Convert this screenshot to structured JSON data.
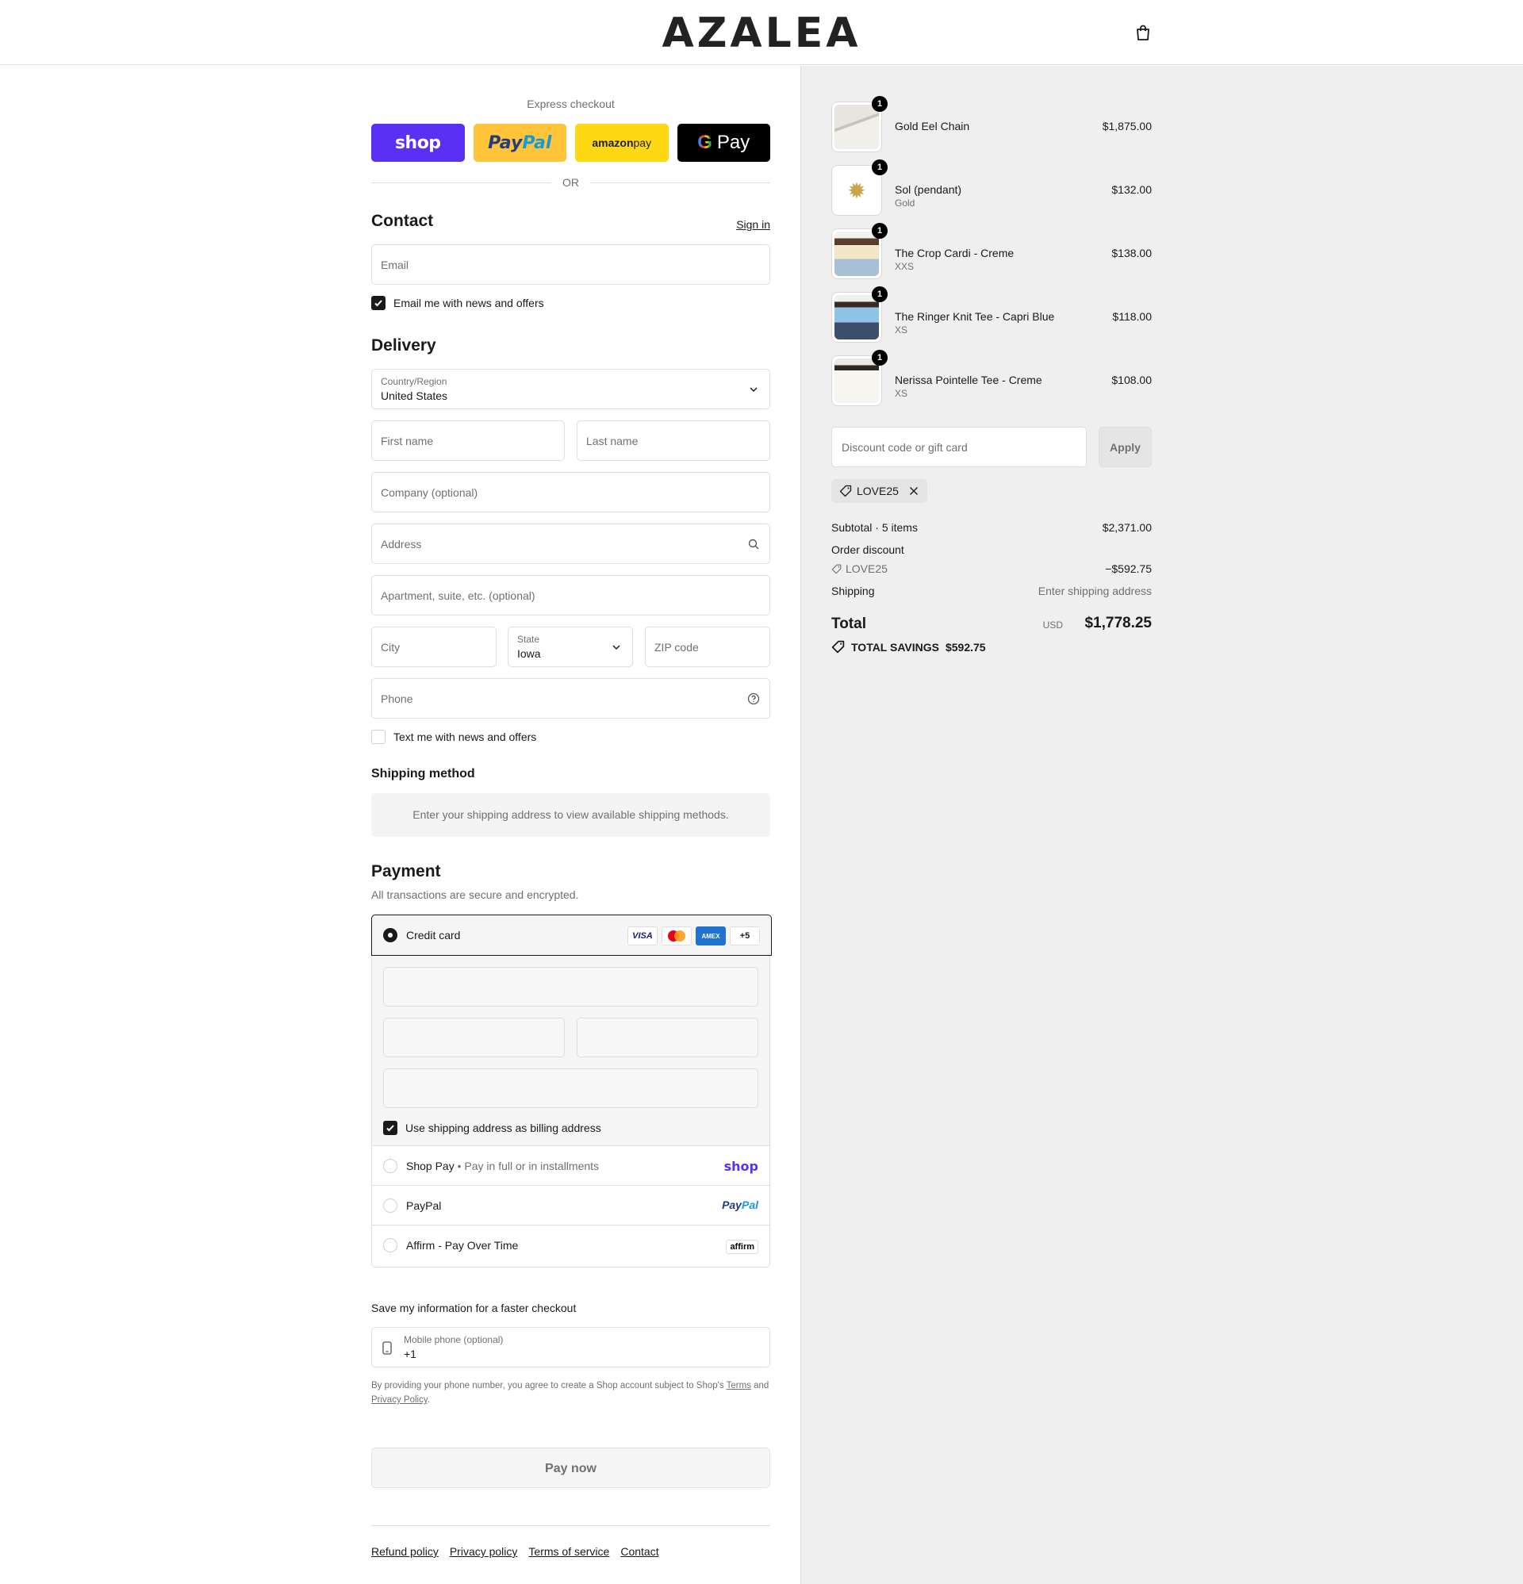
{
  "header": {
    "logo": "AZALEA",
    "cart_icon": "shopping-bag-icon"
  },
  "express": {
    "title": "Express checkout",
    "shop_label": "shop",
    "paypal_1": "Pay",
    "paypal_2": "Pal",
    "amazon_1": "amazon",
    "amazon_2": " pay",
    "gpay_g": "G",
    "gpay_label": "Pay",
    "or": "OR"
  },
  "contact": {
    "heading": "Contact",
    "sign_in": "Sign in",
    "email_placeholder": "Email",
    "email_opt_in": "Email me with news and offers",
    "email_opt_in_checked": true
  },
  "delivery": {
    "heading": "Delivery",
    "country_label": "Country/Region",
    "country_value": "United States",
    "first_name": "First name",
    "last_name": "Last name",
    "company": "Company (optional)",
    "address": "Address",
    "apartment": "Apartment, suite, etc. (optional)",
    "city": "City",
    "state_label": "State",
    "state_value": "Iowa",
    "zip": "ZIP code",
    "phone": "Phone",
    "sms_opt_in": "Text me with news and offers",
    "sms_opt_in_checked": false
  },
  "shipping_method": {
    "heading": "Shipping method",
    "notice": "Enter your shipping address to view available shipping methods."
  },
  "payment": {
    "heading": "Payment",
    "subtitle": "All transactions are secure and encrypted.",
    "credit_card": "Credit card",
    "card_visa": "VISA",
    "card_amex": "AMEX",
    "card_more": "+5",
    "billing_same": "Use shipping address as billing address",
    "billing_same_checked": true,
    "shop_pay": "Shop Pay",
    "shop_pay_sub": "Pay in full or in installments",
    "shop_pay_brand": "shop",
    "paypal": "PayPal",
    "paypal_brand_1": "Pay",
    "paypal_brand_2": "Pal",
    "affirm": "Affirm - Pay Over Time",
    "affirm_brand": "affirm"
  },
  "save_info": {
    "heading": "Save my information for a faster checkout",
    "mobile_label": "Mobile phone (optional)",
    "mobile_value": "+1",
    "fine_1": "By providing your phone number, you agree to create a Shop account subject to Shop's ",
    "fine_terms": "Terms",
    "fine_2": " and ",
    "fine_privacy": "Privacy Policy",
    "fine_3": "."
  },
  "pay_now": "Pay now",
  "footer": [
    "Refund policy",
    "Privacy policy",
    "Terms of service",
    "Contact"
  ],
  "summary": {
    "items": [
      {
        "name": "Gold Eel Chain",
        "variant": "",
        "price": "$1,875.00",
        "qty": "1"
      },
      {
        "name": "Sol (pendant)",
        "variant": "Gold",
        "price": "$132.00",
        "qty": "1"
      },
      {
        "name": "The Crop Cardi - Creme",
        "variant": "XXS",
        "price": "$138.00",
        "qty": "1"
      },
      {
        "name": "The Ringer Knit Tee - Capri Blue",
        "variant": "XS",
        "price": "$118.00",
        "qty": "1"
      },
      {
        "name": "Nerissa Pointelle Tee - Creme",
        "variant": "XS",
        "price": "$108.00",
        "qty": "1"
      }
    ],
    "discount_placeholder": "Discount code or gift card",
    "apply": "Apply",
    "applied_code": "LOVE25",
    "subtotal_label": "Subtotal · 5 items",
    "subtotal_value": "$2,371.00",
    "order_discount_label": "Order discount",
    "order_discount_code": "LOVE25",
    "order_discount_value": "−$592.75",
    "shipping_label": "Shipping",
    "shipping_value": "Enter shipping address",
    "total_label": "Total",
    "total_currency": "USD",
    "total_value": "$1,778.25",
    "savings_label": "TOTAL SAVINGS",
    "savings_value": "$592.75"
  },
  "colors": {
    "shop_purple": "#5a31f4",
    "paypal_yellow": "#ffc439",
    "amazon_yellow": "#ffd814",
    "summary_bg": "#efefef"
  }
}
